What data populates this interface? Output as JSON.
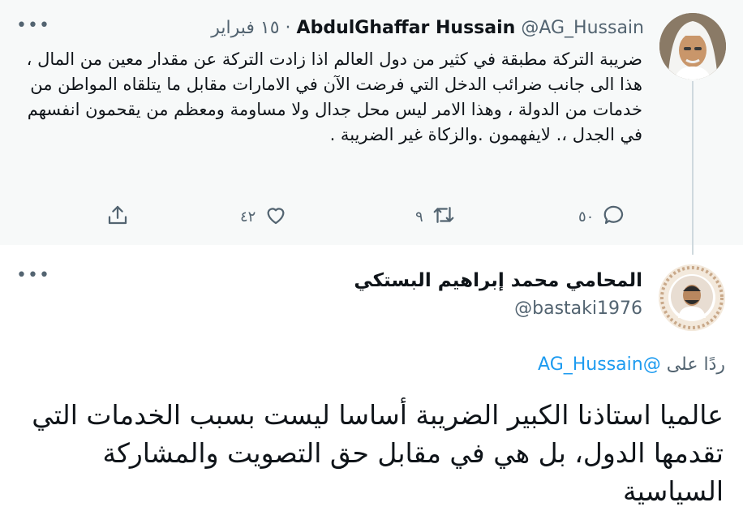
{
  "parent_tweet": {
    "author_name": "AbdulGhaffar Hussain",
    "author_handle": "@AG_Hussain",
    "separator": "·",
    "date": "١٥ فبراير",
    "text": "ضريبة التركة مطبقة في كثير من دول العالم اذا زادت التركة عن مقدار معين من المال ، هذا الى جانب ضرائب الدخل التي فرضت الآن في الامارات مقابل ما يتلقاه المواطن من خدمات من الدولة ، وهذا الامر ليس محل جدال ولا مساومة ومعظم من يقحمون انفسهم في الجدل ،. لايفهمون .والزكاة غير الضريبة .",
    "reply_count": "٥٠",
    "retweet_count": "٩",
    "like_count": "٤٢",
    "more_menu": "•••"
  },
  "reply_tweet": {
    "author_name": "المحامي محمد إبراهيم البستكي",
    "author_handle": "@bastaki1976",
    "replying_to_label": "ردًا على",
    "replying_to_handle": "@AG_Hussain",
    "text": "عالميا استاذنا الكبير الضريبة أساسا ليست بسبب الخدمات التي تقدمها الدول، بل هي في مقابل حق التصويت والمشاركة السياسية",
    "more_menu": "•••"
  },
  "icons": {
    "reply": "reply-icon",
    "retweet": "retweet-icon",
    "like": "heart-icon",
    "share": "share-icon",
    "more": "more-horizontal-icon"
  },
  "colors": {
    "link": "#1d9bf0",
    "secondary_text": "#536471",
    "parent_background": "#f7f9f9",
    "thread_line": "#cfd9de"
  }
}
